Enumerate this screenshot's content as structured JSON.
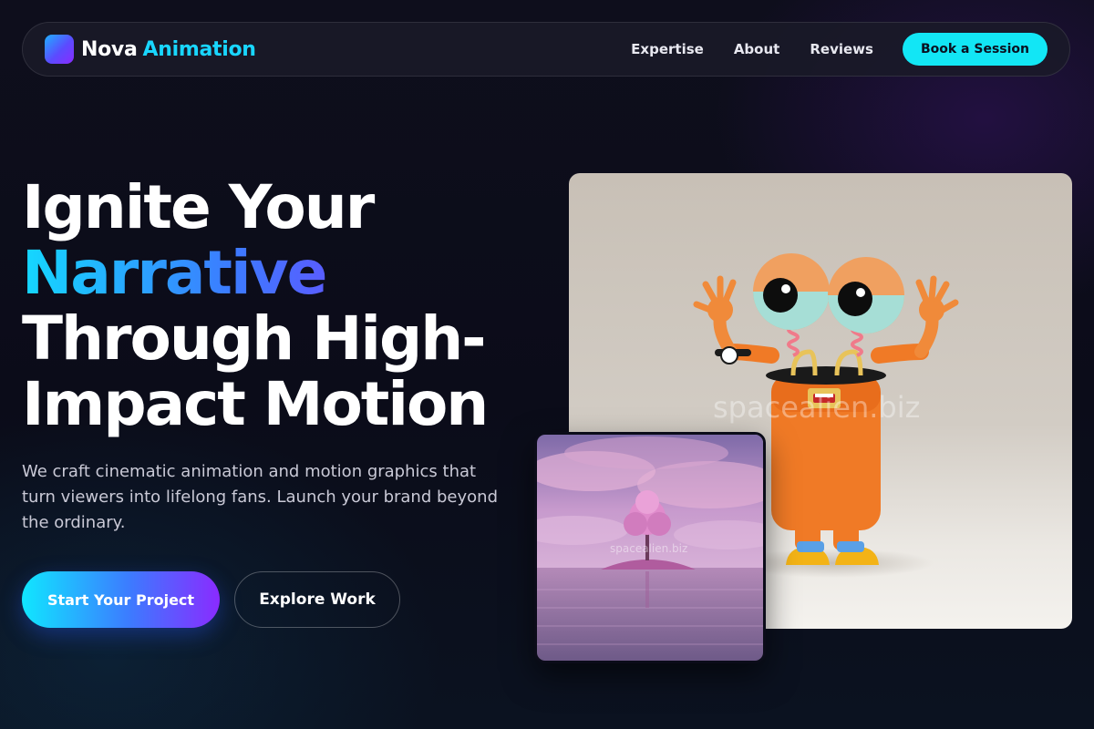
{
  "nav": {
    "brand_word1": "Nova",
    "brand_word2": "Animation",
    "links": [
      {
        "label": "Expertise"
      },
      {
        "label": "About"
      },
      {
        "label": "Reviews"
      }
    ],
    "cta_label": "Book a Session"
  },
  "hero": {
    "headline_line1": "Ignite Your",
    "headline_line2": "Narrative",
    "headline_line3": "Through High-",
    "headline_line4": "Impact Motion",
    "subtext": "We craft cinematic animation and motion graphics that turn viewers into lifelong fans. Launch your brand beyond the ordinary.",
    "primary_button": "Start Your Project",
    "secondary_button": "Explore Work"
  },
  "media": {
    "main_watermark": "spacealien.biz",
    "small_watermark": "spacealien.biz"
  },
  "colors": {
    "accent_cyan": "#12e6f5",
    "accent_blue": "#3c7bff",
    "accent_purple": "#8a2bff",
    "background": "#0d0e1b"
  }
}
